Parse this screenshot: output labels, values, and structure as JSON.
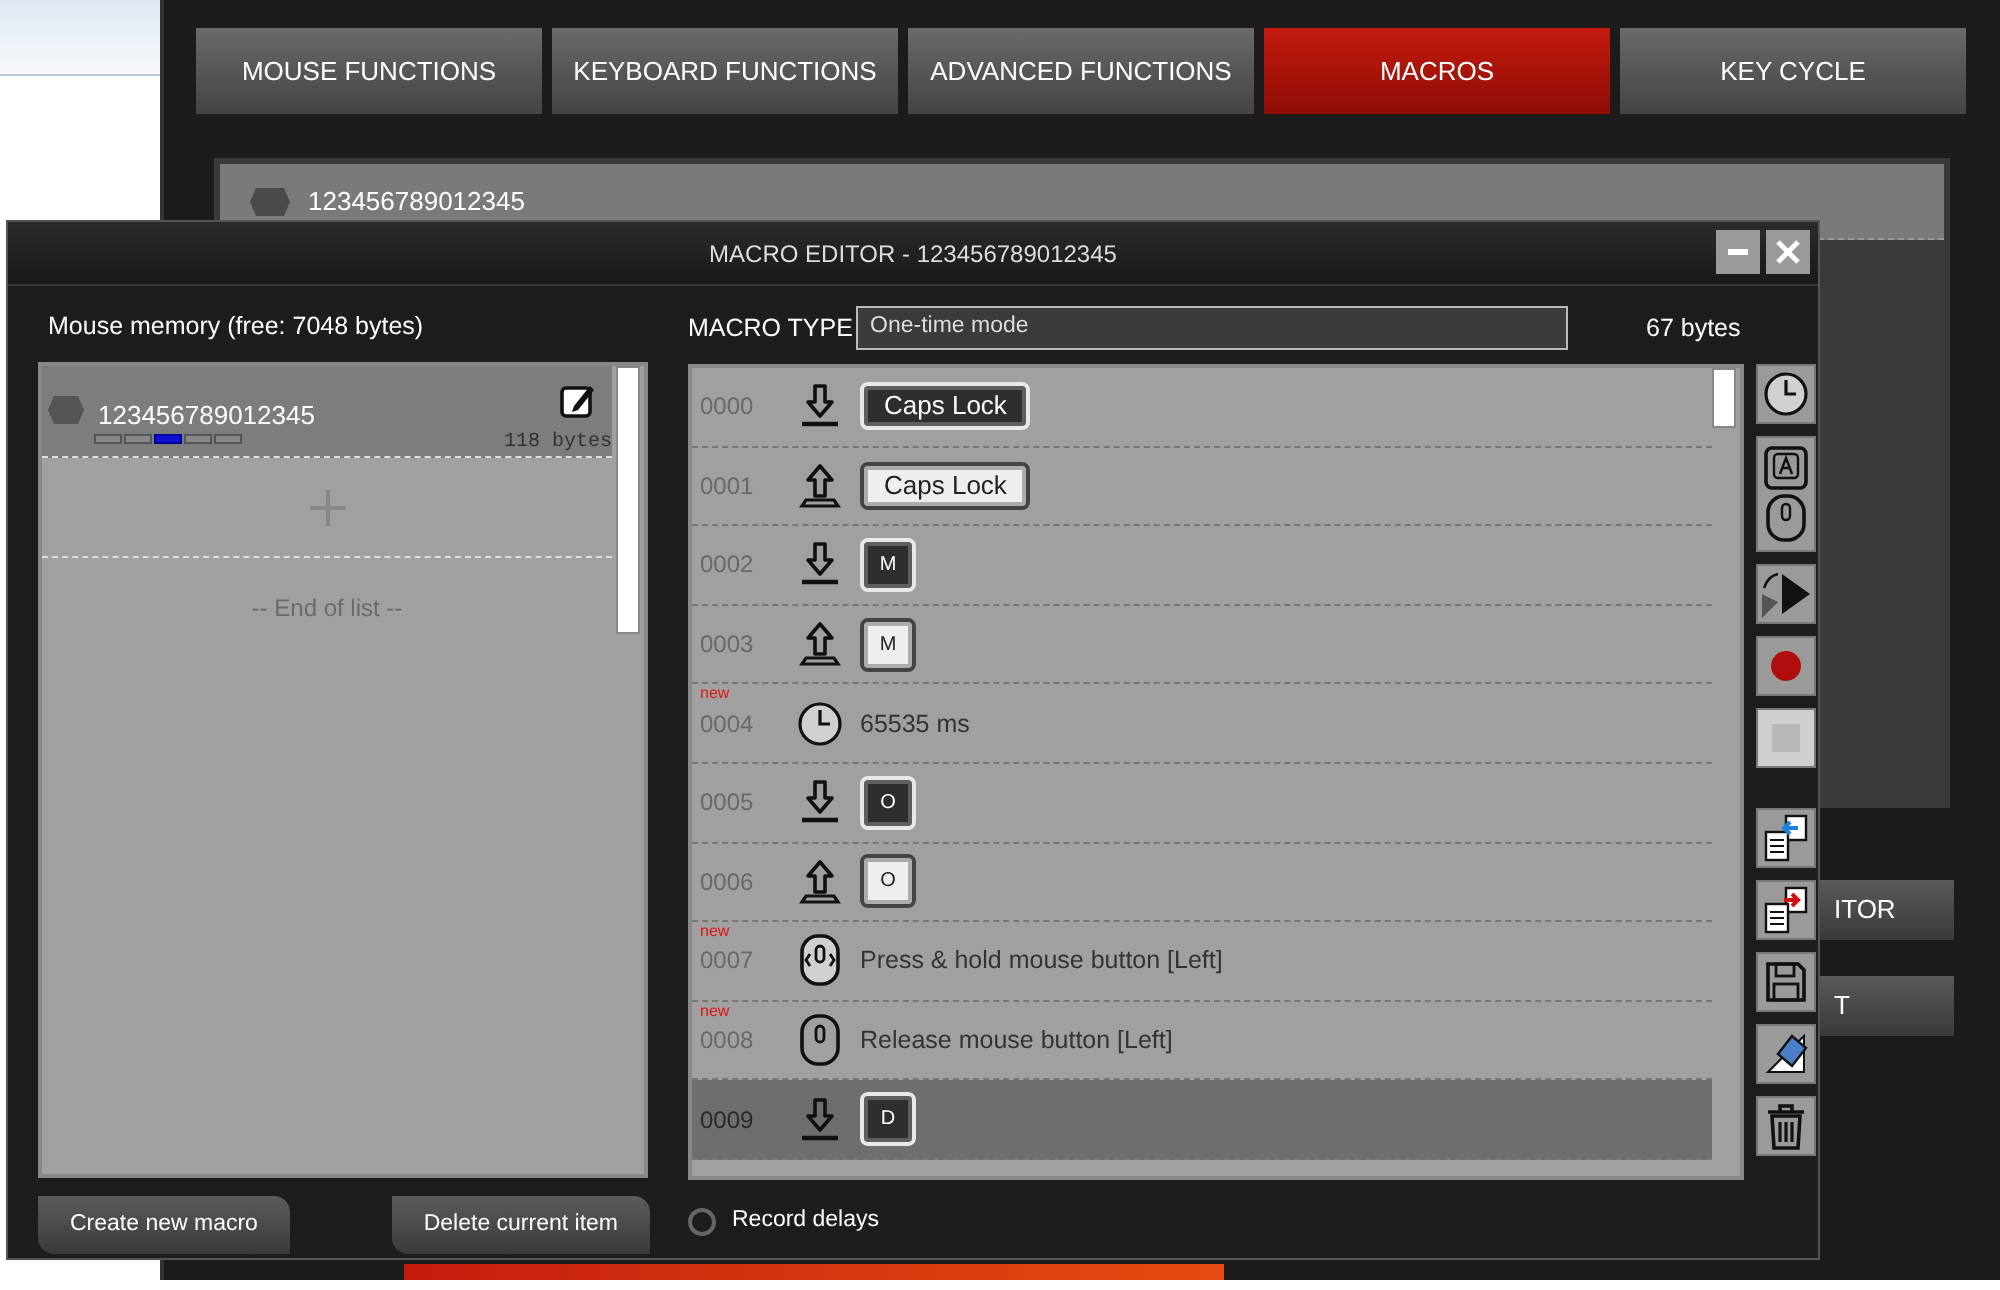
{
  "app": {
    "tabs": [
      {
        "label": "MOUSE FUNCTIONS",
        "selected": false
      },
      {
        "label": "KEYBOARD FUNCTIONS",
        "selected": false
      },
      {
        "label": "ADVANCED FUNCTIONS",
        "selected": false
      },
      {
        "label": "MACROS",
        "selected": true
      },
      {
        "label": "KEY CYCLE",
        "selected": false
      }
    ],
    "macro_row": {
      "name": "123456789012345"
    },
    "side_buttons": [
      "ITOR",
      "T"
    ]
  },
  "editor": {
    "title": "MACRO EDITOR - 123456789012345",
    "memory_label": "Mouse memory (free: 7048 bytes)",
    "macros": [
      {
        "name": "123456789012345",
        "size": "118 bytes",
        "selected": true,
        "slots": [
          {
            "selected": false
          },
          {
            "selected": false
          },
          {
            "selected": true
          },
          {
            "selected": false
          },
          {
            "selected": false
          }
        ]
      }
    ],
    "end_of_list": "-- End of list --",
    "buttons": [
      "Create new macro",
      "Delete current item"
    ],
    "macro_type_label": "MACRO TYPE",
    "macro_type": "One-time mode",
    "size": "67 bytes",
    "steps": [
      {
        "index": "0000",
        "kind": "key_down",
        "key": "Caps Lock",
        "selected": false
      },
      {
        "index": "0001",
        "kind": "key_up",
        "key": "Caps Lock",
        "selected": false
      },
      {
        "index": "0002",
        "kind": "key_down",
        "key": "M",
        "selected": false
      },
      {
        "index": "0003",
        "kind": "key_up",
        "key": "M",
        "selected": false
      },
      {
        "index": "0004",
        "kind": "delay",
        "text": "65535 ms",
        "tag": "new",
        "selected": false
      },
      {
        "index": "0005",
        "kind": "key_down",
        "key": "O",
        "selected": false
      },
      {
        "index": "0006",
        "kind": "key_up",
        "key": "O",
        "selected": false
      },
      {
        "index": "0007",
        "kind": "mouse_press",
        "text": "Press & hold mouse button [Left]",
        "tag": "new",
        "selected": false
      },
      {
        "index": "0008",
        "kind": "mouse_release",
        "text": "Release mouse button [Left]",
        "tag": "new",
        "selected": false
      },
      {
        "index": "0009",
        "kind": "key_down",
        "key": "D",
        "selected": true
      }
    ],
    "toolbar": [
      {
        "kind": "delay",
        "disabled": false
      },
      {
        "kind": "key_mouse",
        "disabled": false
      },
      {
        "kind": "play",
        "disabled": false
      },
      {
        "kind": "record",
        "disabled": false
      },
      {
        "kind": "stop",
        "disabled": true
      },
      {
        "kind": "copy",
        "disabled": false
      },
      {
        "kind": "paste",
        "disabled": false
      },
      {
        "kind": "save",
        "disabled": false
      },
      {
        "kind": "erase",
        "disabled": false
      },
      {
        "kind": "delete",
        "disabled": false
      }
    ],
    "record_delays": {
      "label": "Record delays",
      "checked": false
    }
  }
}
